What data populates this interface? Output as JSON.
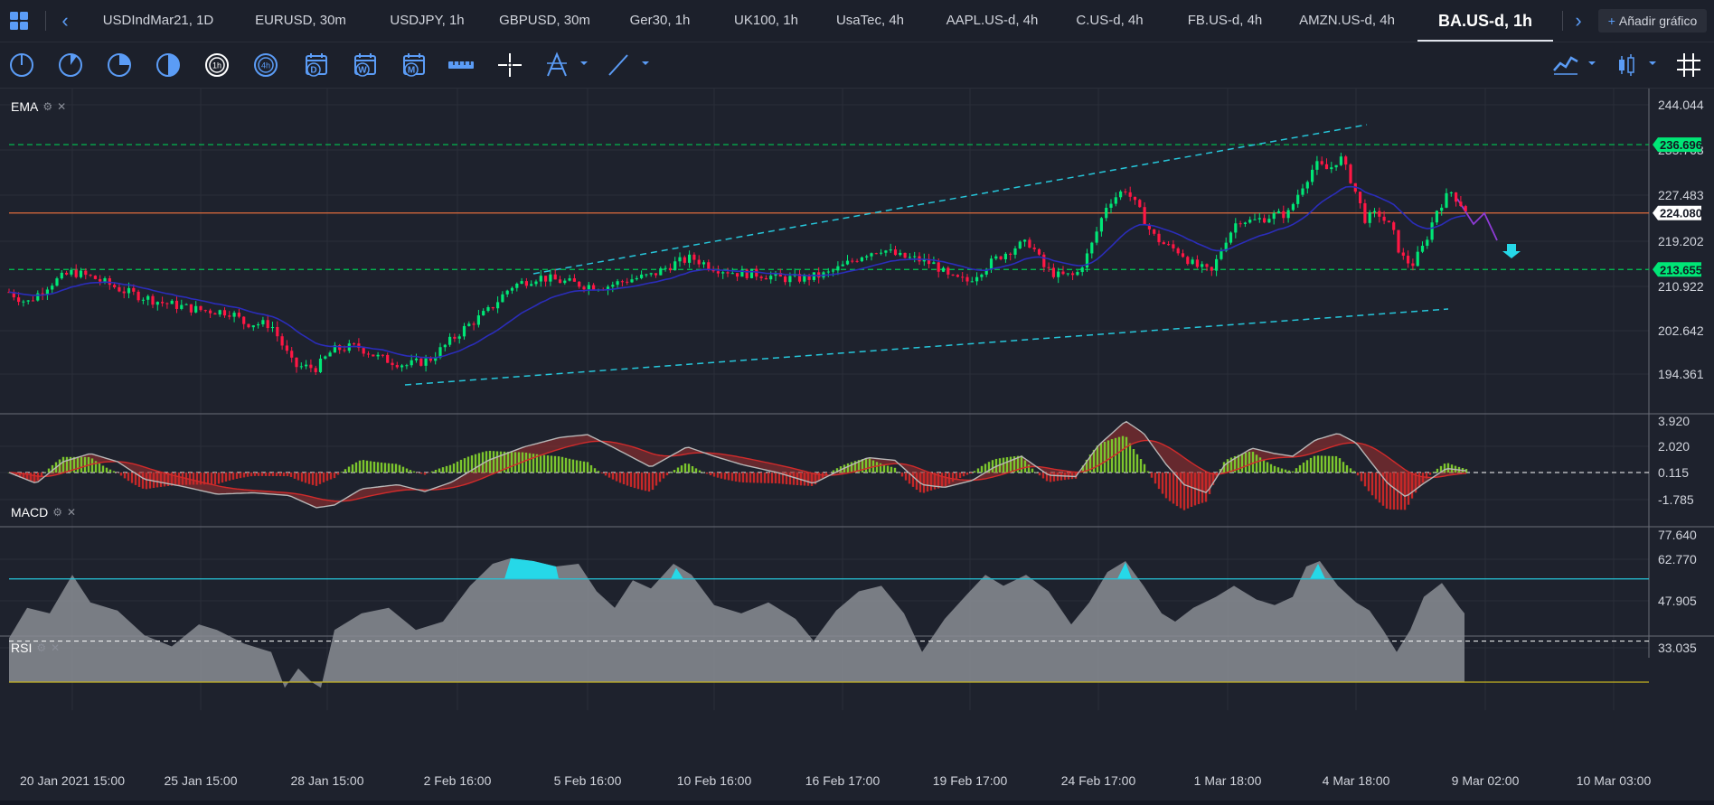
{
  "tabs": [
    {
      "label": "USDIndMar21, 1D"
    },
    {
      "label": "EURUSD, 30m"
    },
    {
      "label": "USDJPY, 1h"
    },
    {
      "label": "GBPUSD, 30m"
    },
    {
      "label": "Ger30, 1h"
    },
    {
      "label": "UK100, 1h"
    },
    {
      "label": "UsaTec, 4h"
    },
    {
      "label": "AAPL.US-d, 4h"
    },
    {
      "label": "C.US-d, 4h"
    },
    {
      "label": "FB.US-d, 4h"
    },
    {
      "label": "AMZN.US-d, 4h"
    },
    {
      "label": "BA.US-d, 1h"
    }
  ],
  "add_chart_label": "Añadir gráfico",
  "tools": [
    {
      "icon": "clock-1m-icon"
    },
    {
      "icon": "clock-5m-icon"
    },
    {
      "icon": "clock-15m-icon"
    },
    {
      "icon": "clock-30m-icon"
    },
    {
      "icon": "clock-1h-icon",
      "text": "1h"
    },
    {
      "icon": "clock-4h-icon",
      "text": "4h"
    },
    {
      "icon": "calendar-day-icon",
      "text": "D"
    },
    {
      "icon": "calendar-week-icon",
      "text": "W"
    },
    {
      "icon": "calendar-month-icon",
      "text": "M"
    },
    {
      "icon": "ruler-icon"
    },
    {
      "icon": "crosshair-icon"
    },
    {
      "icon": "fibonacci-icon"
    },
    {
      "icon": "trendline-icon"
    },
    {
      "icon": "line-chart-type-icon"
    },
    {
      "icon": "candlestick-type-icon"
    },
    {
      "icon": "grid-icon"
    }
  ],
  "panes": {
    "main": {
      "label": "EMA"
    },
    "macd": {
      "label": "MACD"
    },
    "rsi": {
      "label": "RSI"
    }
  },
  "price_axis": {
    "main": [
      "244.044",
      "235.763",
      "227.483",
      "219.202",
      "210.922",
      "202.642",
      "194.361"
    ],
    "macd": [
      "3.920",
      "2.020",
      "0.115",
      "-1.785"
    ],
    "rsi": [
      "77.640",
      "62.770",
      "47.905",
      "33.035"
    ]
  },
  "price_labels": [
    {
      "value": "236.696",
      "color": "#00e676"
    },
    {
      "value": "224.080",
      "color": "#ffffff"
    },
    {
      "value": "213.655",
      "color": "#00e676"
    }
  ],
  "time_axis": [
    "20 Jan 2021 15:00",
    "25 Jan 15:00",
    "28 Jan 15:00",
    "2 Feb 16:00",
    "5 Feb 16:00",
    "10 Feb 16:00",
    "16 Feb 17:00",
    "19 Feb 17:00",
    "24 Feb 17:00",
    "1 Mar 18:00",
    "4 Mar 18:00",
    "9 Mar 02:00",
    "10 Mar 03:00"
  ],
  "colors": {
    "up": "#00e676",
    "down": "#ff1744",
    "ema": "#2b2dba",
    "level": "#00c853",
    "resistance": "#e06c3c",
    "channel": "#26c6da",
    "macd_line": "#b7b7b7",
    "signal_line": "#d12b2b",
    "rsi_fill": "#8a8d94",
    "rsi_over": "#26d8e8"
  }
}
